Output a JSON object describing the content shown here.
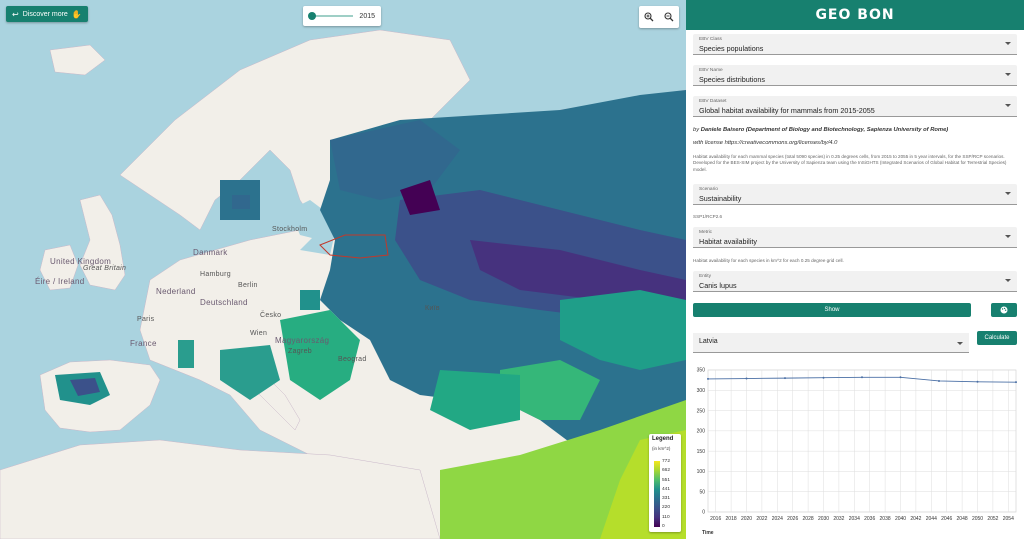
{
  "map": {
    "discover_label": "Discover more",
    "year": "2015",
    "labels": {
      "kingdom": "United Kingdom",
      "britain": "Great Britain",
      "ireland": "Éire / Ireland",
      "denmark": "Danmark",
      "nederland": "Nederland",
      "hamburg": "Hamburg",
      "deutschland": "Deutschland",
      "france": "France",
      "paris": "Paris",
      "cesko": "Česko",
      "magyarorszag": "Magyarország",
      "zagreb": "Zagreb",
      "stockholm": "Stockholm",
      "berlin": "Berlin",
      "wien": "Wien",
      "beograd": "Beograd",
      "kyiv": "Київ"
    },
    "legend": {
      "title": "Legend",
      "unit": "(in km^2)",
      "ticks": [
        "772",
        "662",
        "551",
        "441",
        "331",
        "220",
        "110",
        "0"
      ]
    }
  },
  "panel": {
    "logo": "GEO BON",
    "ebv_class": {
      "label": "EBV Class",
      "value": "Species populations"
    },
    "ebv_name": {
      "label": "EBV Name",
      "value": "Species distributions"
    },
    "ebv_dataset": {
      "label": "EBV Dataset",
      "value": "Global habitat availability for mammals from 2015-2055"
    },
    "author_prefix": "by",
    "author": "Daniele Baisero (Department of Biology and Biotechnology, Sapienza University of Rome)",
    "license_prefix": "with license",
    "license": "https://creativecommons.org/licenses/by/4.0",
    "dataset_description": "Habitat availability for each mammal species (total 5090 species) in 0.25 degrees cells, from 2015 to 2055 in 5 year intervals, for the SSP/RCP scenarios. Developed for the BES-SIM project by the University of Sapienza team using the InSiGHTS (Integrated Scenarios of Global Habitat for Terrestrial Species) model.",
    "scenario": {
      "label": "Scenario",
      "value": "Sustainability"
    },
    "scenario_note": "SSP1/RCP2.6",
    "metric": {
      "label": "Metric",
      "value": "Habitat availability"
    },
    "metric_note": "Habitat availability for each species in km^2 for each 0.25 degree grid cell.",
    "entity": {
      "label": "Entity",
      "value": "Canis lupus"
    },
    "show_label": "Show",
    "country": "Latvia",
    "calculate_label": "Calculate",
    "accent": "#17806f"
  },
  "chart_data": {
    "type": "line",
    "title": "",
    "xlabel": "Time",
    "ylabel": "",
    "x_ticks": [
      "2016",
      "2018",
      "2020",
      "2022",
      "2024",
      "2026",
      "2028",
      "2030",
      "2032",
      "2034",
      "2036",
      "2038",
      "2040",
      "2042",
      "2044",
      "2046",
      "2048",
      "2050",
      "2052",
      "2054"
    ],
    "y_ticks": [
      0,
      50,
      100,
      150,
      200,
      250,
      300,
      350
    ],
    "ylim": [
      0,
      350
    ],
    "xlim": [
      2015,
      2055
    ],
    "grid": true,
    "series": [
      {
        "color": "#4a6fa5",
        "x": [
          2015,
          2020,
          2025,
          2030,
          2035,
          2040,
          2045,
          2050,
          2055
        ],
        "values": [
          328,
          329,
          330,
          331,
          332,
          332,
          323,
          321,
          320
        ]
      }
    ]
  }
}
